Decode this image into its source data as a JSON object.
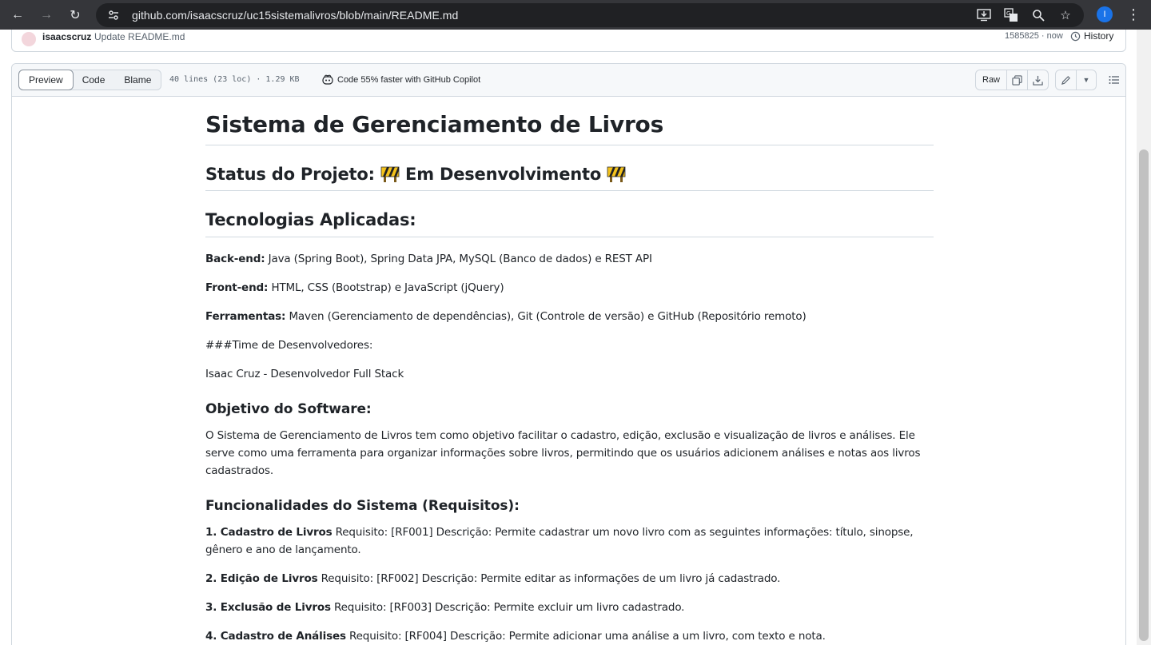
{
  "browser": {
    "url": "github.com/isaacscruz/uc15sistemalivros/blob/main/README.md",
    "profile_initial": "I"
  },
  "commit": {
    "author": "isaacscruz",
    "message": "Update README.md",
    "sha_time": "1585825 · now",
    "history_label": "History"
  },
  "file_header": {
    "tabs": [
      "Preview",
      "Code",
      "Blame"
    ],
    "info": "40 lines (23 loc) · 1.29 KB",
    "copilot": "Code 55% faster with GitHub Copilot",
    "raw_label": "Raw"
  },
  "readme": {
    "title": "Sistema de Gerenciamento de Livros",
    "status_heading": "Status do Projeto:",
    "status_text": "Em Desenvolvimento",
    "tech_heading": "Tecnologias Aplicadas:",
    "backend_label": "Back-end:",
    "backend_text": " Java (Spring Boot), Spring Data JPA, MySQL (Banco de dados) e REST API",
    "frontend_label": "Front-end:",
    "frontend_text": " HTML, CSS (Bootstrap) e JavaScript (jQuery)",
    "tools_label": "Ferramentas:",
    "tools_text": " Maven (Gerenciamento de dependências), Git (Controle de versão) e GitHub (Repositório remoto)",
    "team_heading_raw": "###Time de Desenvolvedores:",
    "team_member": "Isaac Cruz - Desenvolvedor Full Stack",
    "objective_heading": "Objetivo do Software:",
    "objective_text": "O Sistema de Gerenciamento de Livros tem como objetivo facilitar o cadastro, edição, exclusão e visualização de livros e análises. Ele serve como uma ferramenta para organizar informações sobre livros, permitindo que os usuários adicionem análises e notas aos livros cadastrados.",
    "features_heading": "Funcionalidades do Sistema (Requisitos):",
    "features": [
      {
        "label": "1. Cadastro de Livros",
        "text": " Requisito: [RF001] Descrição: Permite cadastrar um novo livro com as seguintes informações: título, sinopse, gênero e ano de lançamento."
      },
      {
        "label": "2. Edição de Livros",
        "text": " Requisito: [RF002] Descrição: Permite editar as informações de um livro já cadastrado."
      },
      {
        "label": "3. Exclusão de Livros",
        "text": " Requisito: [RF003] Descrição: Permite excluir um livro cadastrado."
      },
      {
        "label": "4. Cadastro de Análises",
        "text": " Requisito: [RF004] Descrição: Permite adicionar uma análise a um livro, com texto e nota."
      }
    ]
  }
}
